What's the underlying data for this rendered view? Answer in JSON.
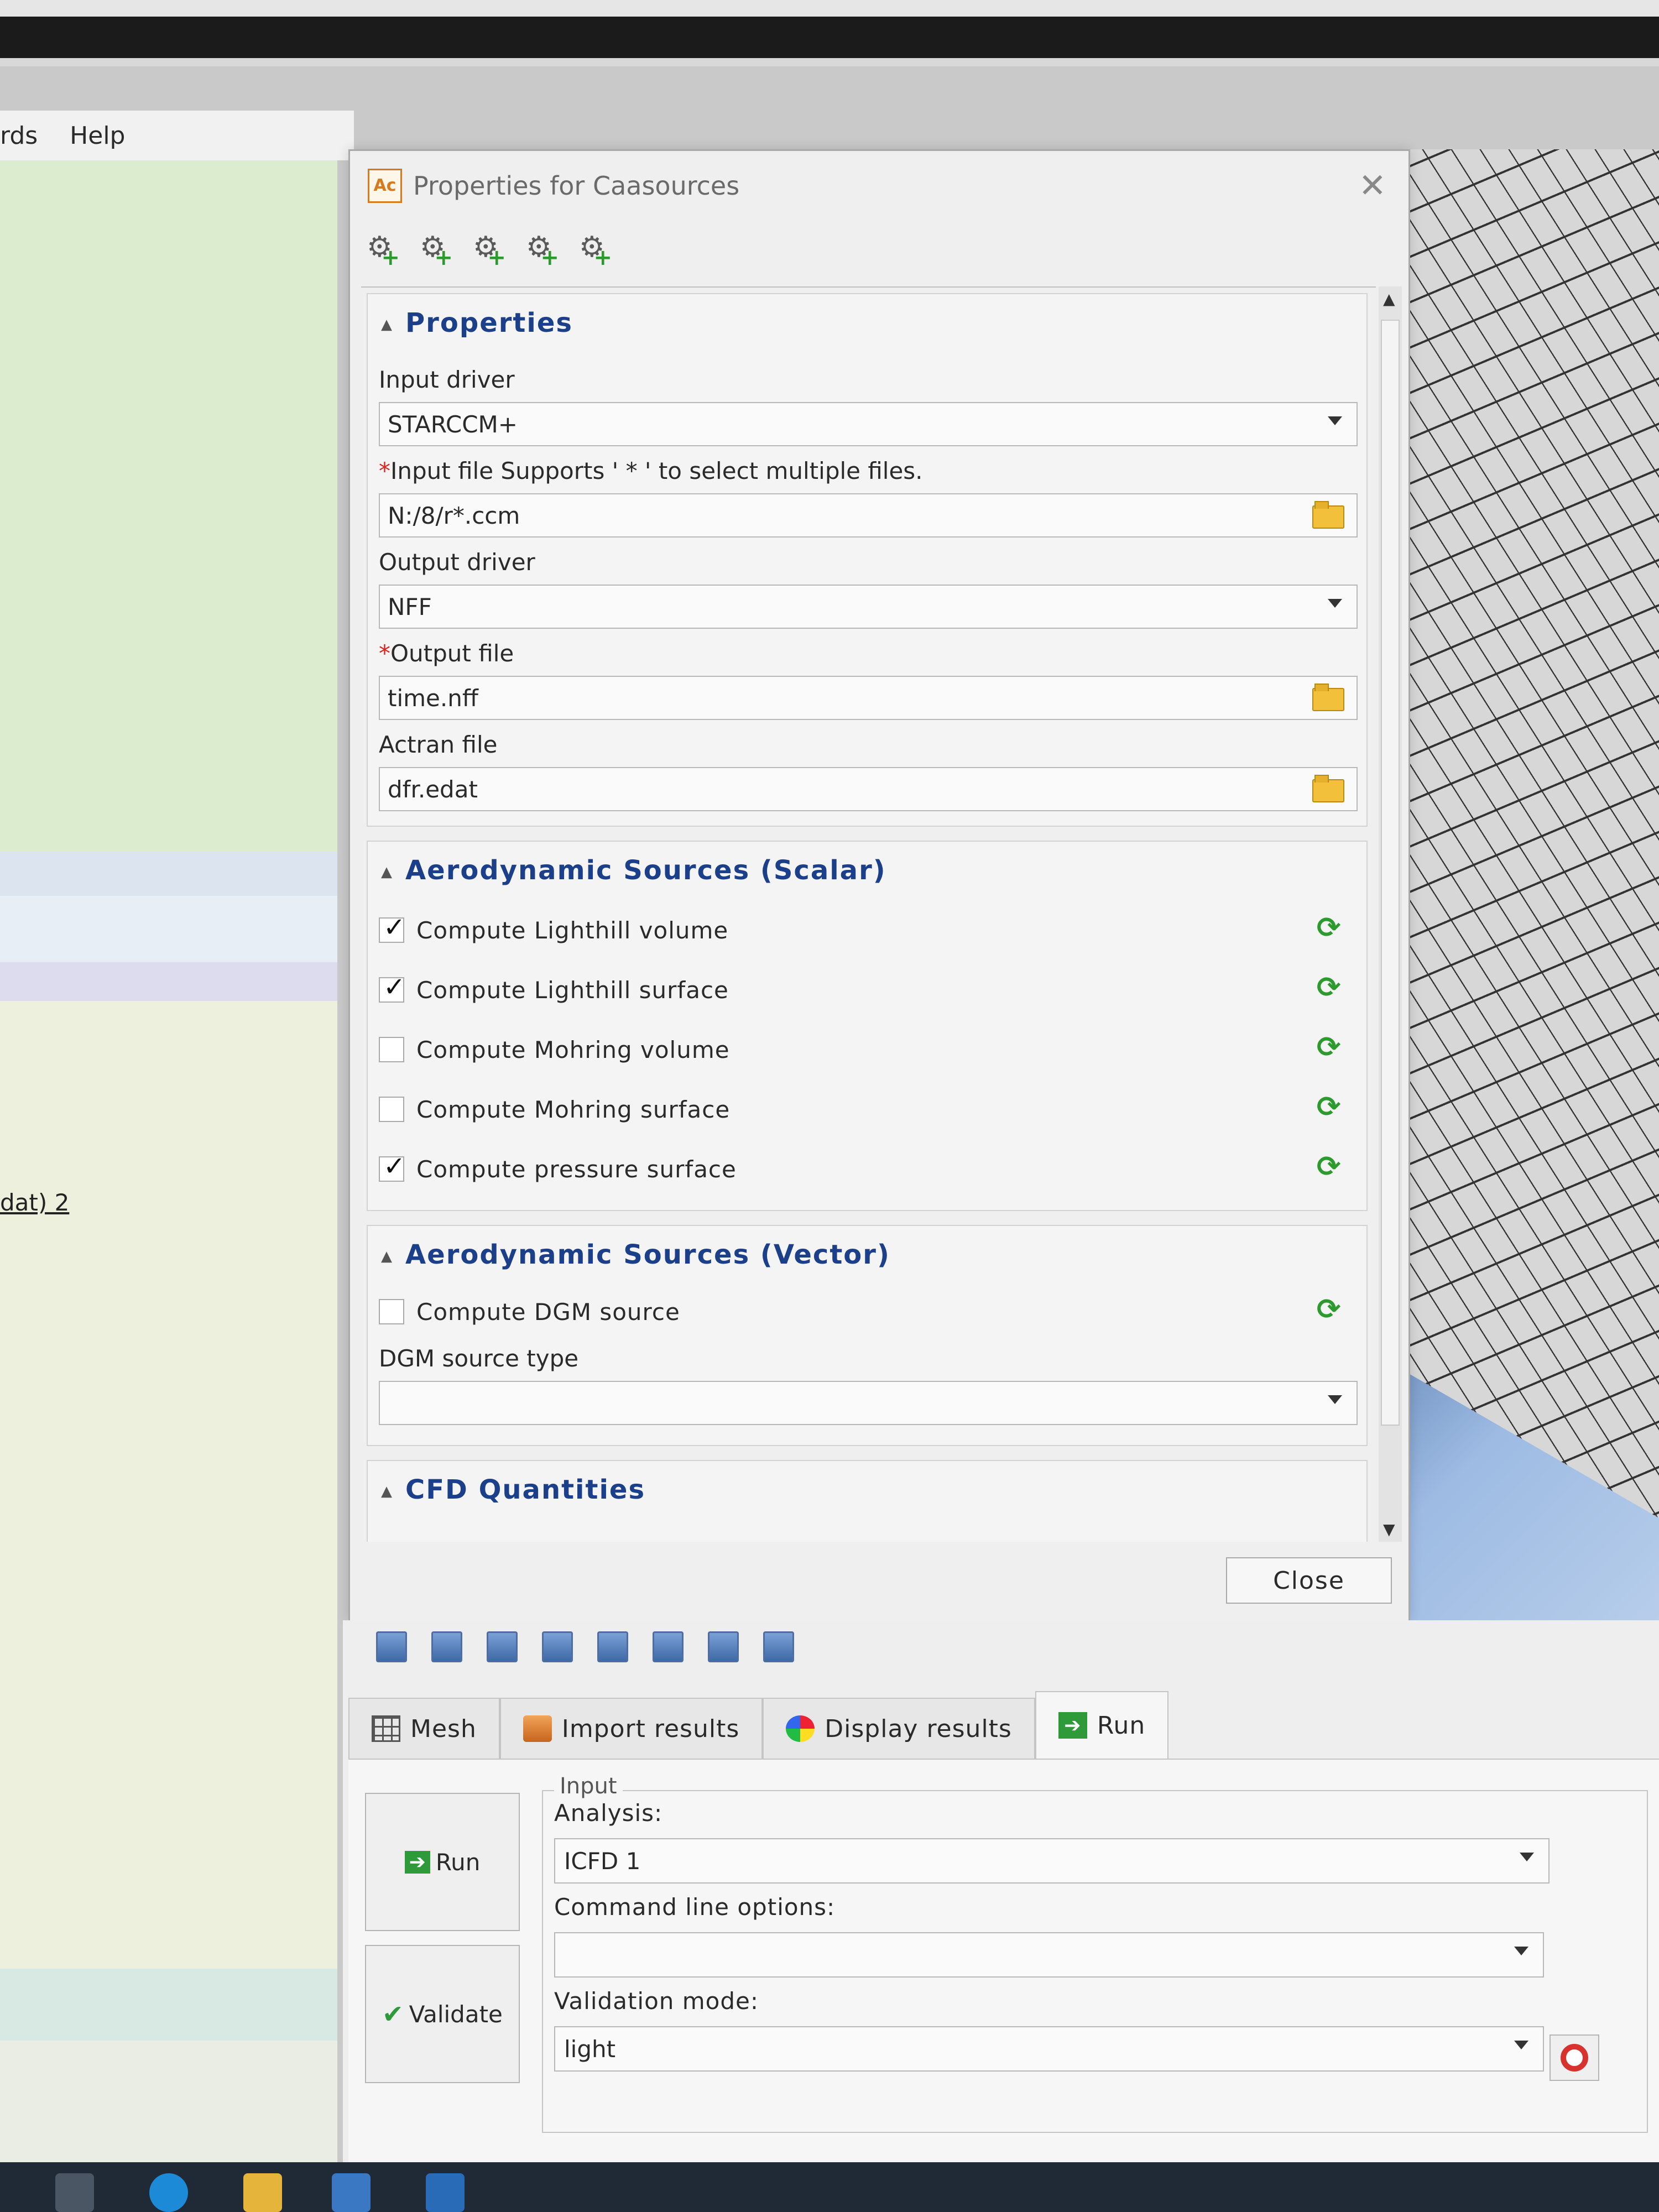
{
  "menubar": {
    "items": [
      "rds",
      "Help"
    ]
  },
  "left_panel": {
    "link_text": "dat) 2"
  },
  "dialog": {
    "app_icon": "Ac",
    "title": "Properties for Caasources",
    "close_icon": "close-icon",
    "toolbar_icons": [
      "add-gear-icon",
      "add-gear-icon",
      "add-gear-icon",
      "add-gear-icon",
      "add-gear-icon"
    ],
    "properties": {
      "header": "Properties",
      "input_driver": {
        "label": "Input driver",
        "value": "STARCCM+"
      },
      "input_file": {
        "required": "*",
        "label": "Input file Supports ' * ' to select multiple files.",
        "value": "N:/8/r*.ccm"
      },
      "output_driver": {
        "label": "Output driver",
        "value": "NFF"
      },
      "output_file": {
        "required": "*",
        "label": "Output file",
        "value": "time.nff"
      },
      "actran_file": {
        "label": "Actran file",
        "value": "dfr.edat"
      }
    },
    "aero_scalar": {
      "header": "Aerodynamic Sources (Scalar)",
      "items": [
        {
          "label": "Compute Lighthill volume",
          "checked": true
        },
        {
          "label": "Compute Lighthill surface",
          "checked": true
        },
        {
          "label": "Compute Mohring volume",
          "checked": false
        },
        {
          "label": "Compute Mohring surface",
          "checked": false
        },
        {
          "label": "Compute pressure surface",
          "checked": true
        }
      ]
    },
    "aero_vector": {
      "header": "Aerodynamic Sources (Vector)",
      "dgm_source": {
        "label": "Compute DGM source",
        "checked": false
      },
      "dgm_type": {
        "label": "DGM source type",
        "value": ""
      }
    },
    "cfd": {
      "header": "CFD Quantities"
    },
    "close_label": "Close"
  },
  "bottom": {
    "tabs": [
      {
        "label": "Mesh",
        "icon": "mesh-icon"
      },
      {
        "label": "Import results",
        "icon": "import-icon"
      },
      {
        "label": "Display results",
        "icon": "display-results-icon"
      },
      {
        "label": "Run",
        "icon": "run-icon"
      }
    ],
    "run_button": "Run",
    "validate_button": "Validate",
    "input_group": "Input",
    "analysis": {
      "label": "Analysis:",
      "value": "ICFD 1"
    },
    "cmd_options": {
      "label": "Command line options:",
      "value": ""
    },
    "validation_mode": {
      "label": "Validation mode:",
      "value": "light"
    }
  },
  "colors": {
    "section_header": "#1c3f8a",
    "required": "#dd2222",
    "accent_green": "#2f9a3a"
  }
}
